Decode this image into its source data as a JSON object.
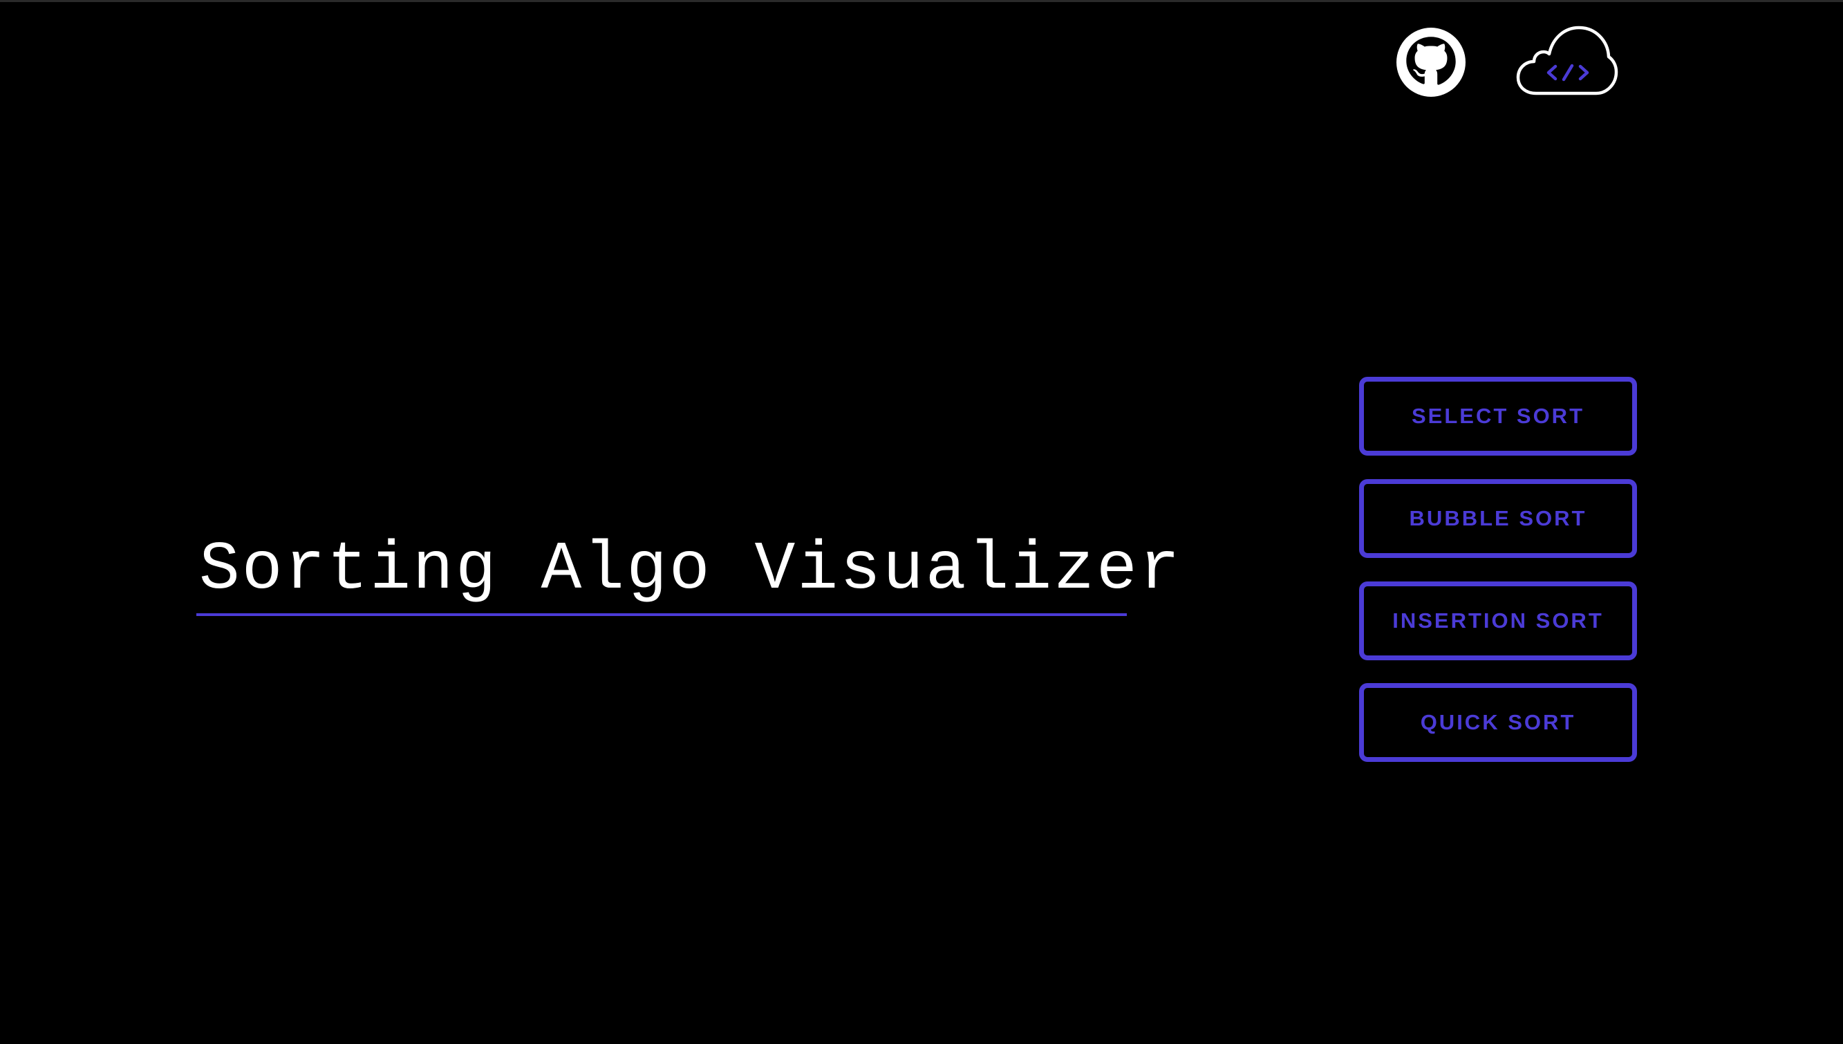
{
  "header": {
    "icons": [
      {
        "name": "github-icon"
      },
      {
        "name": "cloud-code-icon"
      }
    ]
  },
  "main": {
    "title": "Sorting Algo Visualizer"
  },
  "menu": {
    "buttons": [
      {
        "label": "SELECT SORT"
      },
      {
        "label": "BUBBLE SORT"
      },
      {
        "label": "INSERTION SORT"
      },
      {
        "label": "QUICK SORT"
      }
    ]
  },
  "colors": {
    "background": "#000000",
    "accent": "#4b3bd6",
    "text": "#ffffff"
  }
}
